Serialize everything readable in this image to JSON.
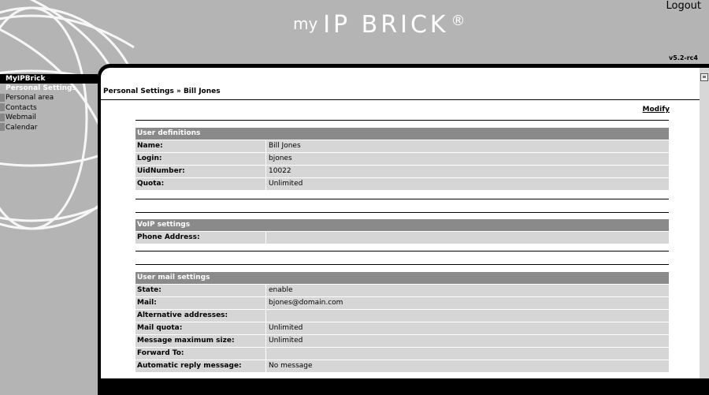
{
  "header": {
    "logo": {
      "prefix": "my",
      "brand": "IP BRICK",
      "mark": "®"
    },
    "logout_label": "Logout",
    "version": "v5.2-rc4"
  },
  "sidebar": {
    "title": "MyIPBrick",
    "section": "Personal Settings",
    "items": [
      {
        "label": "Personal area"
      },
      {
        "label": "Contacts"
      },
      {
        "label": "Webmail"
      },
      {
        "label": "Calendar"
      }
    ]
  },
  "content": {
    "title": "Personal Settings » Bill Jones",
    "modify_label": "Modify",
    "sections": {
      "user": {
        "header": "User definitions",
        "rows": [
          {
            "label": "Name:",
            "value": "Bill Jones"
          },
          {
            "label": "Login:",
            "value": "bjones"
          },
          {
            "label": "UidNumber:",
            "value": "10022"
          },
          {
            "label": "Quota:",
            "value": "Unlimited"
          }
        ]
      },
      "voip": {
        "header": "VoIP settings",
        "rows": [
          {
            "label": "Phone Address:",
            "value": ""
          }
        ]
      },
      "mail": {
        "header": "User mail settings",
        "rows": [
          {
            "label": "State:",
            "value": "enable"
          },
          {
            "label": "Mail:",
            "value": "bjones@domain.com"
          },
          {
            "label": "Alternative addresses:",
            "value": ""
          },
          {
            "label": "Mail quota:",
            "value": "Unlimited"
          },
          {
            "label": "Message maximum size:",
            "value": "Unlimited"
          },
          {
            "label": "Forward To:",
            "value": ""
          },
          {
            "label": "Automatic reply message:",
            "value": "No message"
          }
        ]
      }
    }
  }
}
